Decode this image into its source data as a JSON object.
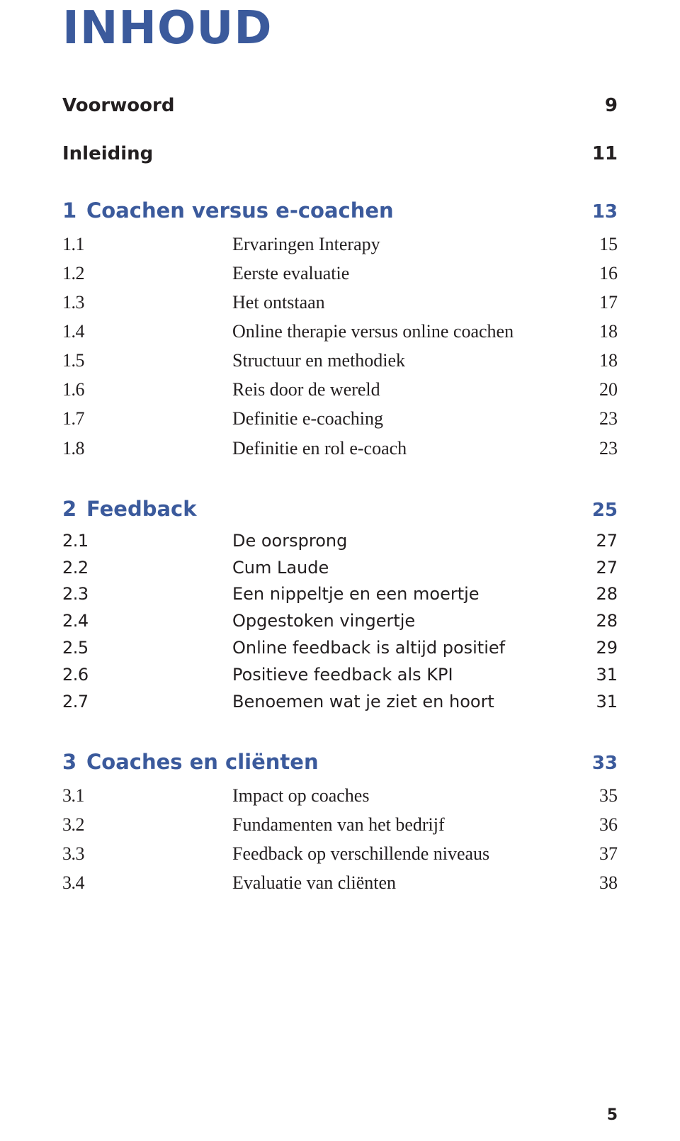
{
  "title": "INHOUD",
  "front_matter": [
    {
      "label": "Voorwoord",
      "page": "9"
    },
    {
      "label": "Inleiding",
      "page": "11"
    }
  ],
  "chapters": [
    {
      "num": "1",
      "label": "Coachen versus e-coachen",
      "page": "13",
      "sections": [
        {
          "num": "1.1",
          "label": "Ervaringen Interapy",
          "page": "15"
        },
        {
          "num": "1.2",
          "label": "Eerste evaluatie",
          "page": "16"
        },
        {
          "num": "1.3",
          "label": "Het ontstaan",
          "page": "17"
        },
        {
          "num": "1.4",
          "label": "Online therapie versus online coachen",
          "page": "18"
        },
        {
          "num": "1.5",
          "label": "Structuur en methodiek",
          "page": "18"
        },
        {
          "num": "1.6",
          "label": "Reis door de wereld",
          "page": "20"
        },
        {
          "num": "1.7",
          "label": "Definitie e-coaching",
          "page": "23"
        },
        {
          "num": "1.8",
          "label": "Definitie en rol e-coach",
          "page": "23"
        }
      ]
    },
    {
      "num": "2",
      "label": "Feedback",
      "page": "25",
      "sections": [
        {
          "num": "2.1",
          "label": "De oorsprong",
          "page": "27"
        },
        {
          "num": "2.2",
          "label": "Cum Laude",
          "page": "27"
        },
        {
          "num": "2.3",
          "label": "Een nippeltje en een moertje",
          "page": "28"
        },
        {
          "num": "2.4",
          "label": "Opgestoken vingertje",
          "page": "28"
        },
        {
          "num": "2.5",
          "label": "Online feedback is altijd positief",
          "page": "29"
        },
        {
          "num": "2.6",
          "label": "Positieve feedback als KPI",
          "page": "31"
        },
        {
          "num": "2.7",
          "label": "Benoemen wat je ziet en hoort",
          "page": "31"
        }
      ]
    },
    {
      "num": "3",
      "label": "Coaches en cliënten",
      "page": "33",
      "sections": [
        {
          "num": "3.1",
          "label": "Impact op coaches",
          "page": "35"
        },
        {
          "num": "3.2",
          "label": "Fundamenten van het bedrijf",
          "page": "36"
        },
        {
          "num": "3.3",
          "label": "Feedback op verschillende niveaus",
          "page": "37"
        },
        {
          "num": "3.4",
          "label": "Evaluatie van cliënten",
          "page": "38"
        }
      ]
    }
  ],
  "footer_page": "5",
  "colors": {
    "accent": "#3b5a9c",
    "text": "#231f20"
  }
}
